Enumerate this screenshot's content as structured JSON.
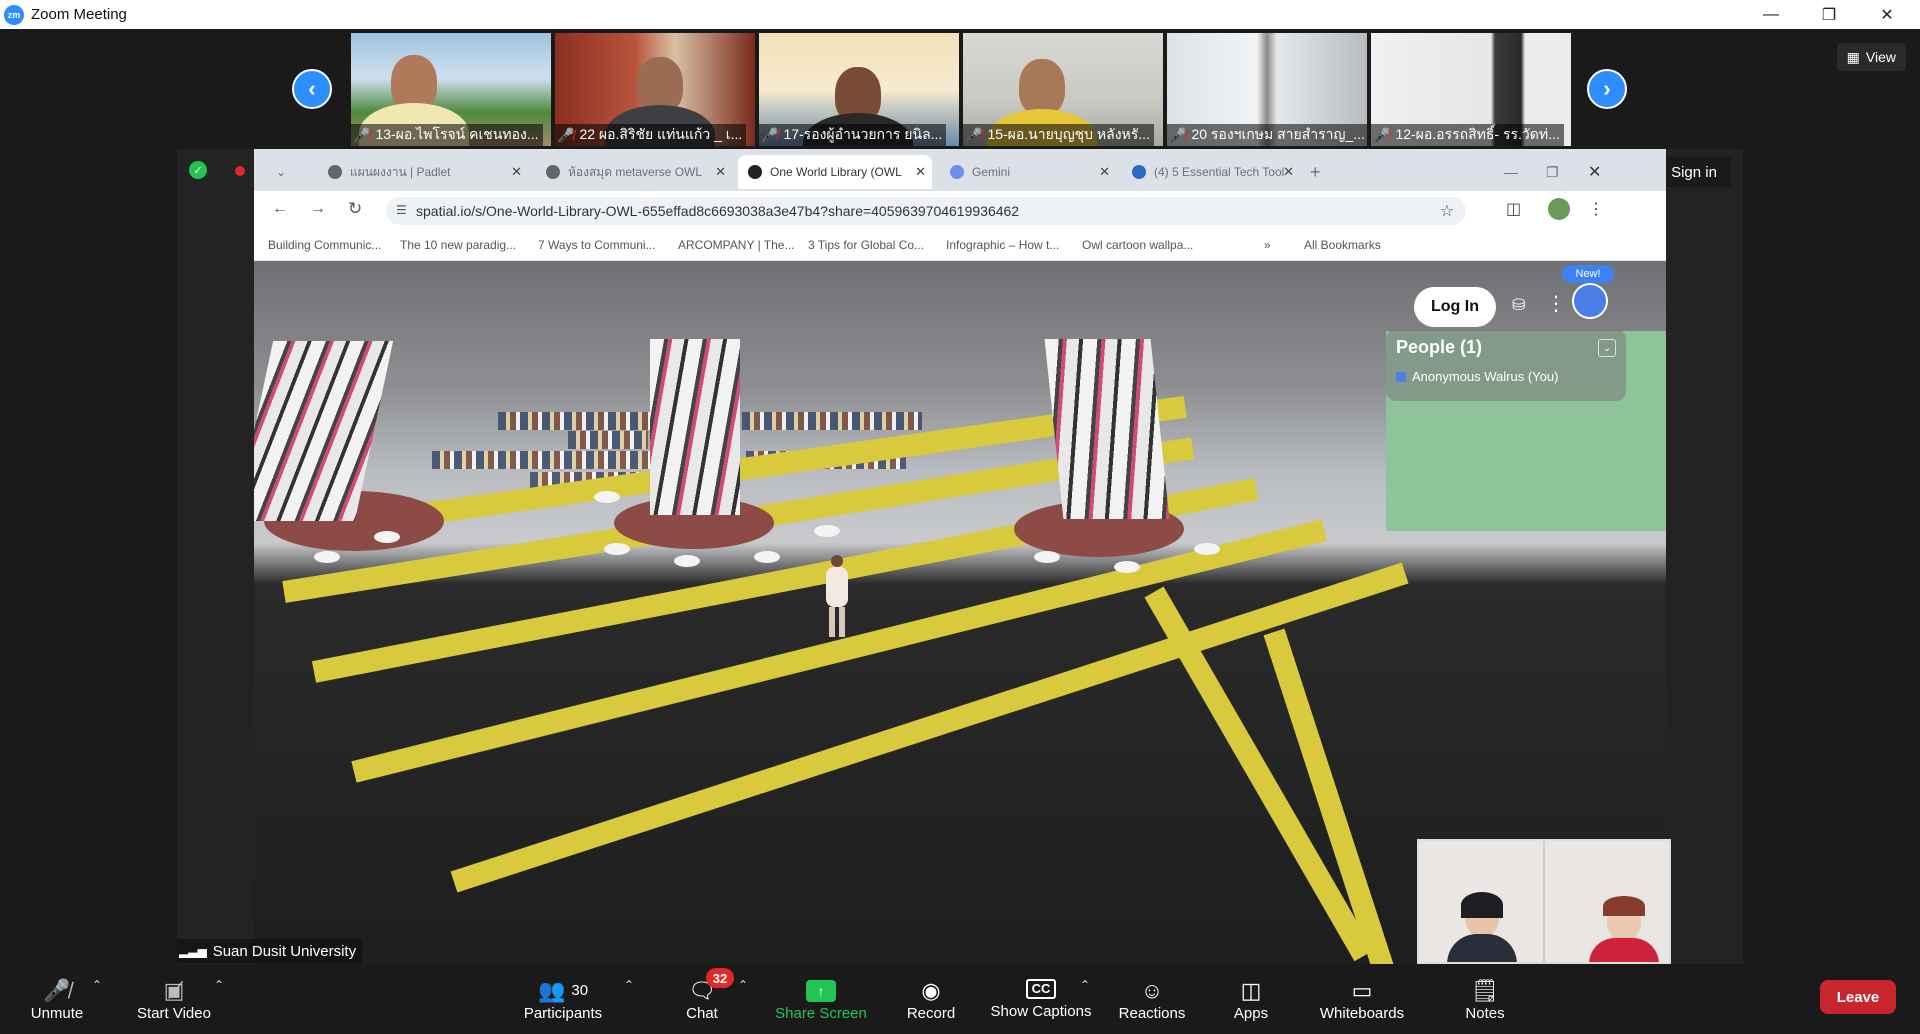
{
  "window": {
    "title": "Zoom Meeting",
    "logo_text": "zm"
  },
  "participants_strip": {
    "prev_icon": "chevron-left-icon",
    "next_icon": "chevron-right-icon",
    "view_label": "View",
    "tiles": [
      {
        "label": "13-ผอ.ไพโรจน์ คเชนทอง..."
      },
      {
        "label": "22 ผอ.สิริชัย แท่นแก้ว _ เ..."
      },
      {
        "label": "17-รองผู้อำนวยการ ยนิล..."
      },
      {
        "label": "15-ผอ.นายบุญชุบ หลังหรั..."
      },
      {
        "label": "20 รองฯเกษม สายสำราญ_..."
      },
      {
        "label": "12-ผอ.อรรถสิทธิ์- รร.วัดท่..."
      }
    ]
  },
  "share": {
    "sign_in": "Sign in",
    "recording_label": "Recording",
    "browser": {
      "tabs": [
        {
          "label": "แผนผงงาน | Padlet"
        },
        {
          "label": "ห้องสมุด metaverse OWL"
        },
        {
          "label": "One World Library (OWL"
        },
        {
          "label": "Gemini"
        },
        {
          "label": "(4) 5 Essential Tech Tool"
        }
      ],
      "url": "spatial.io/s/One-World-Library-OWL-655effad8c6693038a3e47b4?share=4059639704619936462",
      "bookmarks": [
        "Building Communic...",
        "The 10 new paradig...",
        "7 Ways to Communi...",
        "ARCOMPANY | The...",
        "3 Tips for Global Co...",
        "Infographic – How t...",
        "Owl cartoon wallpa...",
        "All Bookmarks"
      ]
    },
    "spatial": {
      "login_label": "Log In",
      "new_badge": "New!",
      "people_header": "People (1)",
      "people_item": "Anonymous Walrus (You)"
    },
    "host_name": "Suan Dusit University"
  },
  "toolbar": {
    "unmute": "Unmute",
    "start_video": "Start Video",
    "participants": "Participants",
    "participants_count": "30",
    "chat": "Chat",
    "chat_badge": "32",
    "share_screen": "Share Screen",
    "record": "Record",
    "show_captions": "Show Captions",
    "reactions": "Reactions",
    "apps": "Apps",
    "whiteboards": "Whiteboards",
    "notes": "Notes",
    "leave": "Leave"
  },
  "colors": {
    "zoom_blue": "#2d8cff",
    "share_green": "#23c552",
    "leave_red": "#c9252d",
    "badge_red": "#e02828"
  }
}
